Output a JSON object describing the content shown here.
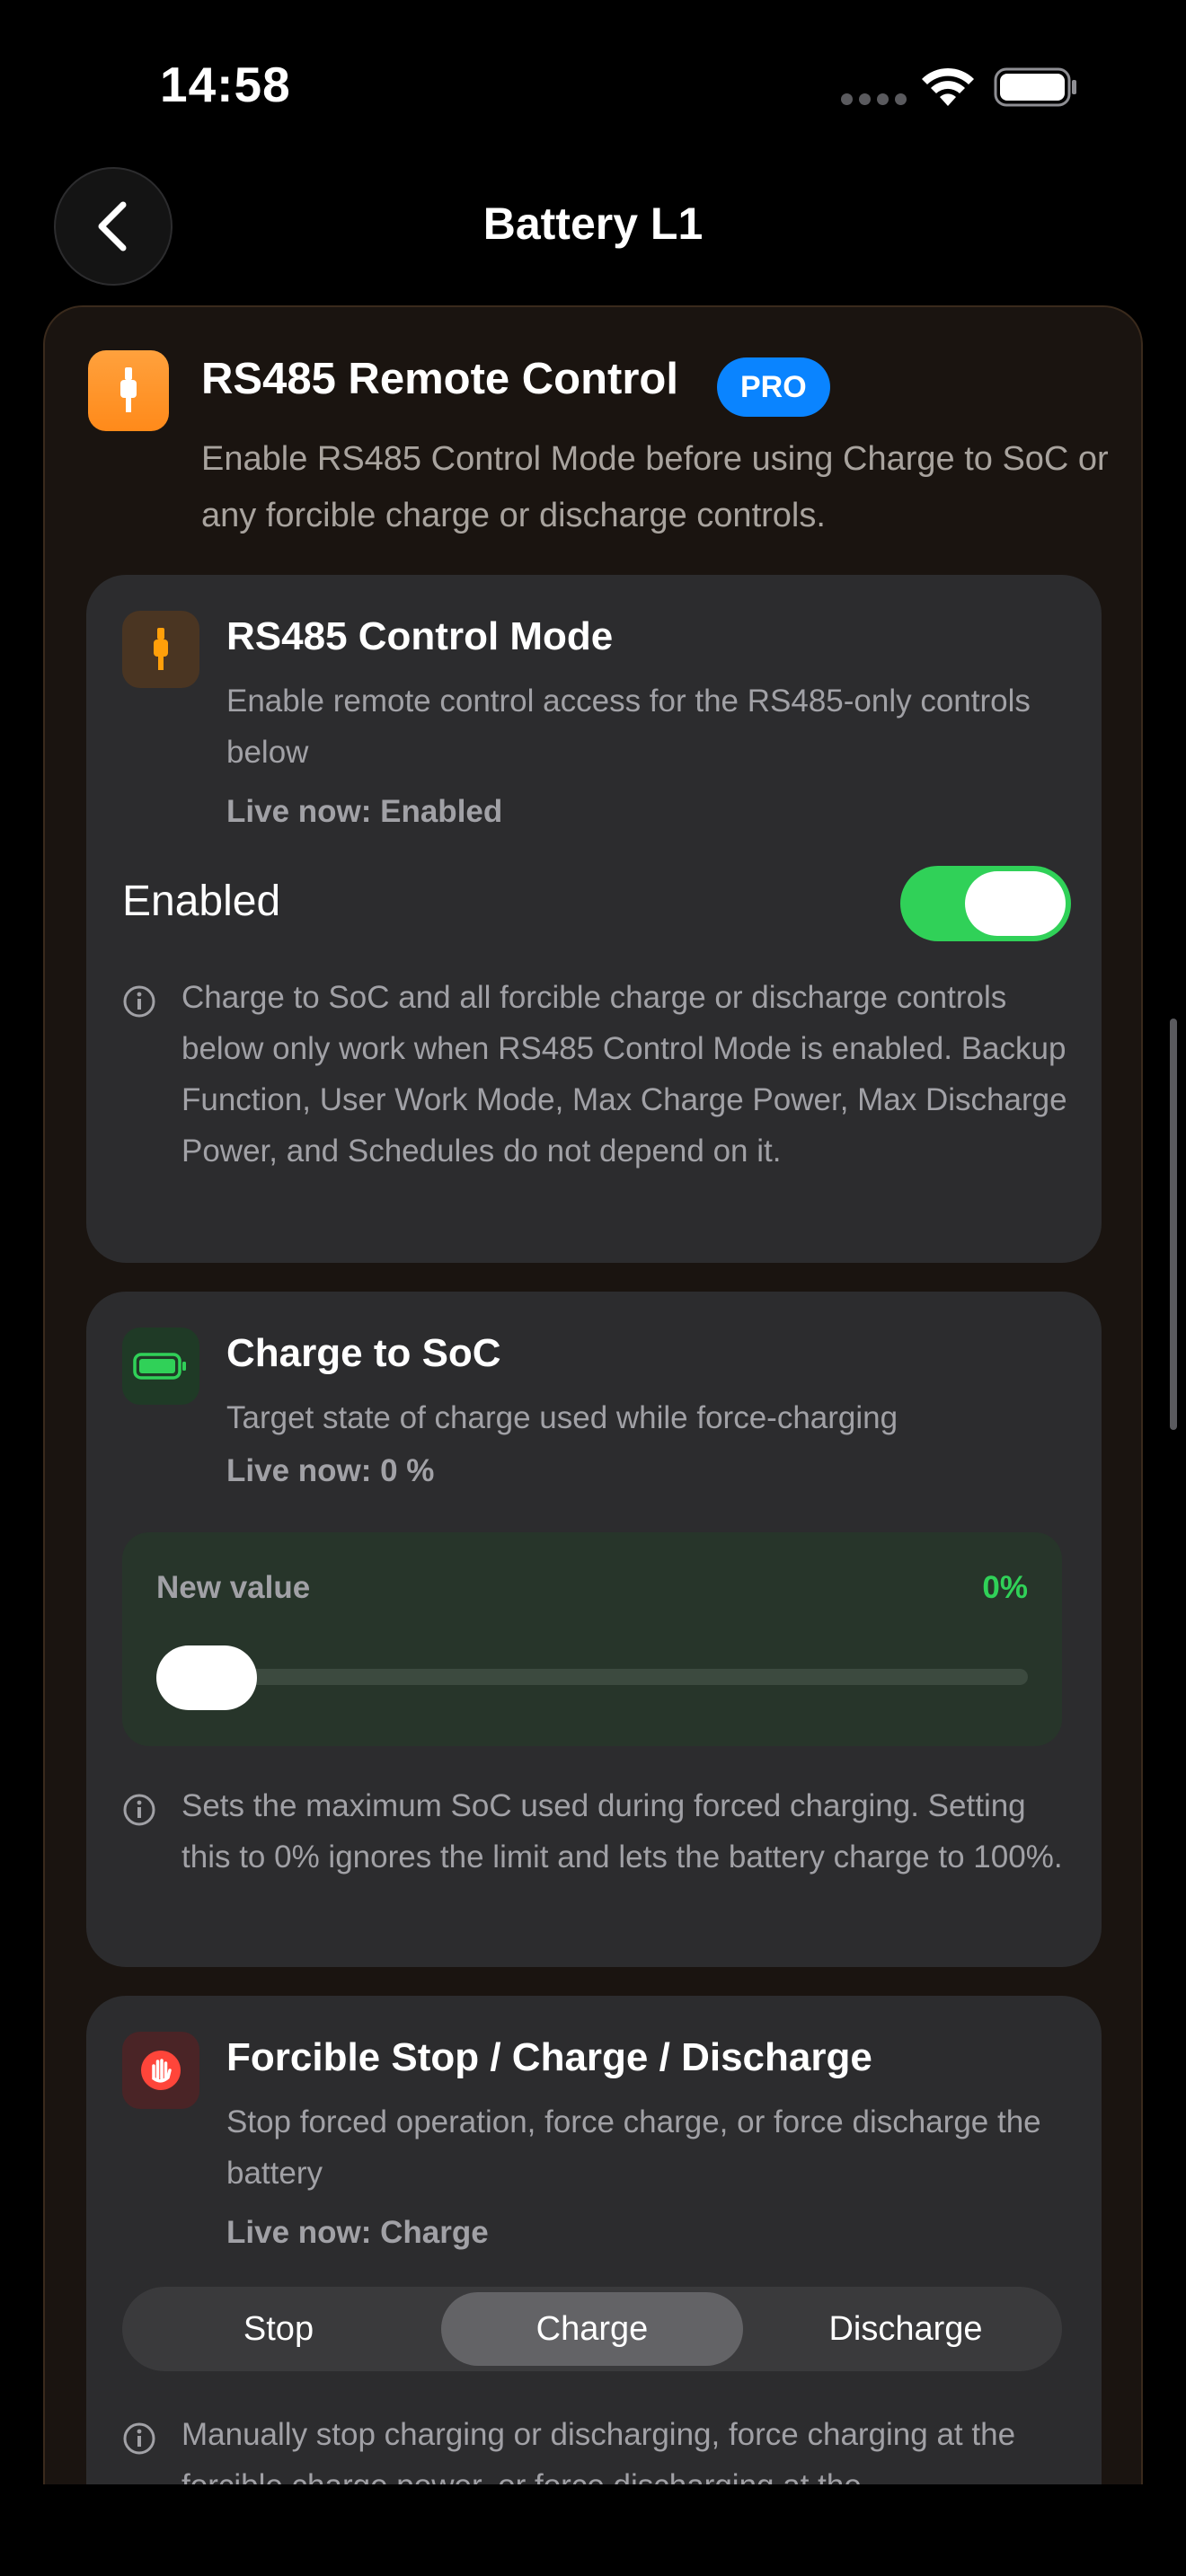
{
  "status_bar": {
    "time": "14:58"
  },
  "nav": {
    "title": "Battery L1"
  },
  "section": {
    "title": "RS485 Remote Control",
    "badge": "PRO",
    "description": "Enable RS485 Control Mode before using Charge to SoC or any forcible charge or discharge controls."
  },
  "control_mode": {
    "title": "RS485 Control Mode",
    "description": "Enable remote control access for the RS485-only controls below",
    "live": "Live now: Enabled",
    "toggle_label": "Enabled",
    "toggle_on": true,
    "info": "Charge to SoC and all forcible charge or discharge controls below only work when RS485 Control Mode is enabled. Backup Function, User Work Mode, Max Charge Power, Max Discharge Power, and Schedules do not depend on it."
  },
  "charge_soc": {
    "title": "Charge to SoC",
    "description": "Target state of charge used while force-charging",
    "live": "Live now: 0 %",
    "slider_label": "New value",
    "slider_value_text": "0%",
    "slider_value": 0,
    "info": "Sets the maximum SoC used during forced charging. Setting this to 0% ignores the limit and lets the battery charge to 100%."
  },
  "forcible": {
    "title": "Forcible Stop / Charge / Discharge",
    "description": "Stop forced operation, force charge, or force discharge the battery",
    "live": "Live now: Charge",
    "segments": [
      "Stop",
      "Charge",
      "Discharge"
    ],
    "selected": "Charge",
    "info": "Manually stop charging or discharging, force charging at the forcible charge power, or force discharging at the"
  },
  "colors": {
    "accent_green": "#30d158",
    "accent_orange": "#ff9f0a",
    "accent_blue": "#0a84ff",
    "danger_red": "#ff453a"
  },
  "icons": {
    "back": "chevron-left-icon",
    "section": "cable-connector-icon",
    "control_mode": "cable-connector-icon",
    "charge_soc": "battery-full-icon",
    "forcible": "hand-raised-icon",
    "info": "info-circle-icon"
  }
}
